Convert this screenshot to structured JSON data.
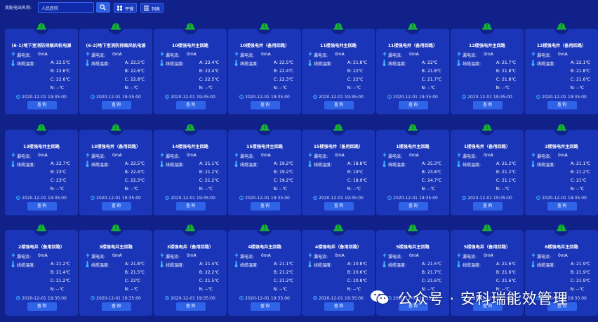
{
  "toolbar": {
    "station_label": "变配电站名称:",
    "search_value": "人民医院",
    "tile_label": "平铺",
    "list_label": "列表"
  },
  "labels": {
    "leakage": "漏电流:",
    "cable_temp": "线缆温度:",
    "query": "查询"
  },
  "colors": {
    "background": "#10228a",
    "card": "#1b35b8",
    "button": "#2f64e8",
    "status_green": "#17b13a"
  },
  "cards": [
    {
      "title": "(6-1)地下室消防排烟风机电源",
      "leakage": "0mA",
      "A": "22.5℃",
      "B": "22.6℃",
      "C": "22.6℃",
      "N": "--℃",
      "time": "2020-12-01 19:35:00"
    },
    {
      "title": "(6-2)地下室消防排烟风机电源",
      "leakage": "0mA",
      "A": "22.5℃",
      "B": "22.6℃",
      "C": "22.8℃",
      "N": "--℃",
      "time": "2020-12-01 19:35:00"
    },
    {
      "title": "10楼强电井主回路",
      "leakage": "0mA",
      "A": "22.4℃",
      "B": "22.4℃",
      "C": "22.5℃",
      "N": "--℃",
      "time": "2020-12-01 19:35:00"
    },
    {
      "title": "10楼强电井（备用回路）",
      "leakage": "0mA",
      "A": "22.5℃",
      "B": "22.4℃",
      "C": "22.3℃",
      "N": "--℃",
      "time": "2020-12-01 19:35:00"
    },
    {
      "title": "11楼强电井主回路",
      "leakage": "0mA",
      "A": "21.8℃",
      "B": "22℃",
      "C": "22℃",
      "N": "--℃",
      "time": "2020-12-01 19:35:00"
    },
    {
      "title": "11楼强电井（备用回路）",
      "leakage": "0mA",
      "A": "22℃",
      "B": "21.8℃",
      "C": "21.7℃",
      "N": "--℃",
      "time": "2020-12-01 19:35:00"
    },
    {
      "title": "12楼强电井主回路",
      "leakage": "0mA",
      "A": "21.7℃",
      "B": "21.8℃",
      "C": "21.8℃",
      "N": "--℃",
      "time": "2020-12-01 19:35:00"
    },
    {
      "title": "12楼强电井（备用回路）",
      "leakage": "0mA",
      "A": "22.1℃",
      "B": "21.8℃",
      "C": "21.6℃",
      "N": "--℃",
      "time": "2020-12-01 19:35:00"
    },
    {
      "title": "13楼强电井主回路",
      "leakage": "0mA",
      "A": "22.7℃",
      "B": "23℃",
      "C": "23℃",
      "N": "--℃",
      "time": "2020-12-01 19:35:00"
    },
    {
      "title": "13楼强电井（备用回路）",
      "leakage": "0mA",
      "A": "22.5℃",
      "B": "22.4℃",
      "C": "22.3℃",
      "N": "--℃",
      "time": "2020-12-01 19:35:00"
    },
    {
      "title": "14楼强电井主回路",
      "leakage": "0mA",
      "A": "21.1℃",
      "B": "21.2℃",
      "C": "21.2℃",
      "N": "--℃",
      "time": "2020-12-01 19:35:00"
    },
    {
      "title": "15楼强电井主回路",
      "leakage": "0mA",
      "A": "19.2℃",
      "B": "19.2℃",
      "C": "19.2℃",
      "N": "--℃",
      "time": "2020-12-01 19:35:00"
    },
    {
      "title": "15楼强电井（备用回路）",
      "leakage": "0mA",
      "A": "18.8℃",
      "B": "19℃",
      "C": "18.9℃",
      "N": "--℃",
      "time": "2020-12-01 19:35:00"
    },
    {
      "title": "1楼强电井主回路",
      "leakage": "0mA",
      "A": "25.3℃",
      "B": "23.8℃",
      "C": "24.7℃",
      "N": "--℃",
      "time": "2020-12-01 19:35:00"
    },
    {
      "title": "1楼强电井（备用回路）",
      "leakage": "0mA",
      "A": "21.2℃",
      "B": "21.2℃",
      "C": "21.1℃",
      "N": "--℃",
      "time": "2020-12-01 19:35:00"
    },
    {
      "title": "2楼强电井主回路",
      "leakage": "0mA",
      "A": "21.1℃",
      "B": "21.2℃",
      "C": "21℃",
      "N": "--℃",
      "time": "2020-12-01 19:35:00"
    },
    {
      "title": "2楼强电井（备用回路）",
      "leakage": "0mA",
      "A": "21.2℃",
      "B": "21.4℃",
      "C": "21.2℃",
      "N": "--℃",
      "time": "2020-12-01 19:35:00"
    },
    {
      "title": "3楼强电井主回路",
      "leakage": "0mA",
      "A": "21.8℃",
      "B": "21.5℃",
      "C": "22℃",
      "N": "--℃",
      "time": "2020-12-01 19:35:00"
    },
    {
      "title": "3楼强电井（备用回路）",
      "leakage": "0mA",
      "A": "21.4℃",
      "B": "22.2℃",
      "C": "21.5℃",
      "N": "--℃",
      "time": "2020-12-01 19:35:00"
    },
    {
      "title": "4楼强电井主回路",
      "leakage": "0mA",
      "A": "21.1℃",
      "B": "21.2℃",
      "C": "21.2℃",
      "N": "--℃",
      "time": "2020-12-01 19:35:00"
    },
    {
      "title": "4楼强电井（备用回路）",
      "leakage": "0mA",
      "A": "20.8℃",
      "B": "20.6℃",
      "C": "20.8℃",
      "N": "--℃",
      "time": "2020-12-01 19:35:00"
    },
    {
      "title": "5楼强电井主回路",
      "leakage": "0mA",
      "A": "21.5℃",
      "B": "21.7℃",
      "C": "21.6℃",
      "N": "--℃",
      "time": "2020-12-01 19:35:00"
    },
    {
      "title": "5楼强电井（备用回路）",
      "leakage": "0mA",
      "A": "21.6℃",
      "B": "21.6℃",
      "C": "21.6℃",
      "N": "--℃",
      "time": "2020-12-01 19:35:00"
    },
    {
      "title": "6楼强电井主回路",
      "leakage": "0mA",
      "A": "21.9℃",
      "B": "21.9℃",
      "C": "21.9℃",
      "N": "--℃",
      "time": "2020-12-01 19:35:00"
    }
  ],
  "watermark": {
    "text": "公众号 · 安科瑞能效管理",
    "icon": "wechat-icon"
  }
}
